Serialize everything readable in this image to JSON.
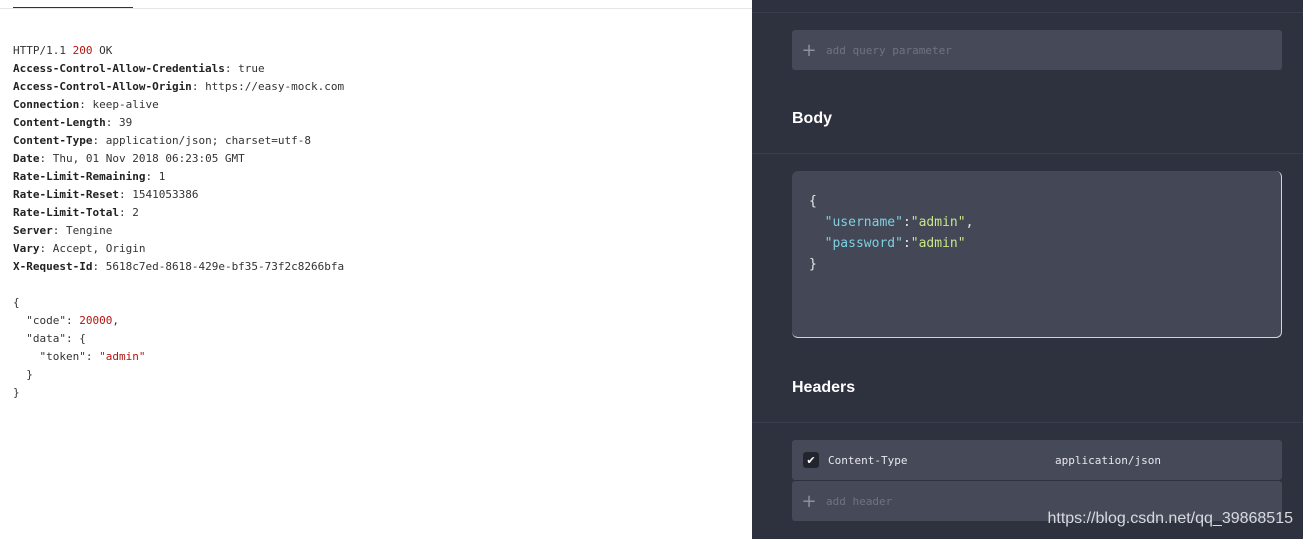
{
  "response": {
    "status_line": {
      "protocol": "HTTP/1.1",
      "code": "200",
      "text": "OK"
    },
    "headers": [
      {
        "key": "Access-Control-Allow-Credentials",
        "value": "true"
      },
      {
        "key": "Access-Control-Allow-Origin",
        "value": "https://easy-mock.com"
      },
      {
        "key": "Connection",
        "value": "keep-alive"
      },
      {
        "key": "Content-Length",
        "value": "39"
      },
      {
        "key": "Content-Type",
        "value": "application/json; charset=utf-8"
      },
      {
        "key": "Date",
        "value": "Thu, 01 Nov 2018 06:23:05 GMT"
      },
      {
        "key": "Rate-Limit-Remaining",
        "value": "1"
      },
      {
        "key": "Rate-Limit-Reset",
        "value": "1541053386"
      },
      {
        "key": "Rate-Limit-Total",
        "value": "2"
      },
      {
        "key": "Server",
        "value": "Tengine"
      },
      {
        "key": "Vary",
        "value": "Accept, Origin"
      },
      {
        "key": "X-Request-Id",
        "value": "5618c7ed-8618-429e-bf35-73f2c8266bfa"
      }
    ],
    "body": {
      "open": "{",
      "code_key": "\"code\"",
      "code_val": "20000",
      "data_key": "\"data\"",
      "token_key": "\"token\"",
      "token_val": "\"admin\"",
      "inner_close": "}",
      "close": "}"
    }
  },
  "request": {
    "query_placeholder": "add query parameter",
    "body_title": "Body",
    "body_code": {
      "open": "{",
      "username_key": "\"username\"",
      "username_val": "\"admin\"",
      "password_key": "\"password\"",
      "password_val": "\"admin\"",
      "close": "}"
    },
    "headers_title": "Headers",
    "headers": [
      {
        "key": "Content-Type",
        "value": "application/json",
        "checked": true
      }
    ],
    "header_placeholder": "add header"
  },
  "watermark": "https://blog.csdn.net/qq_39868515",
  "icons": {
    "add": "plus-icon",
    "check": "checkmark-icon"
  }
}
